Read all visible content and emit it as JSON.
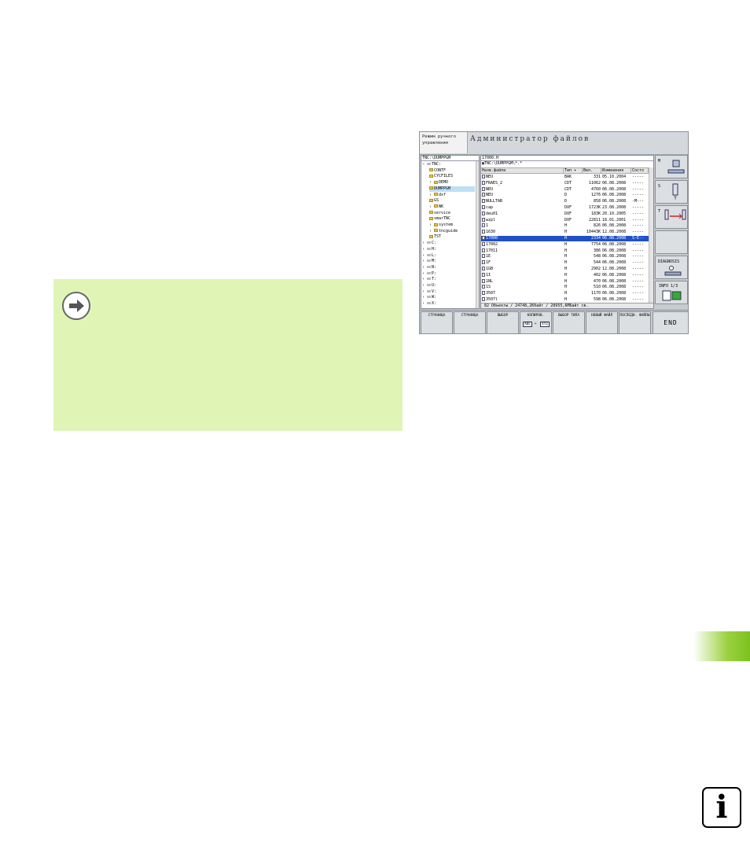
{
  "screen": {
    "mode_label": "Режим ручного управления",
    "title": "Администратор файлов",
    "tree": {
      "path": "TNC:\\DUMPPGM",
      "items": [
        {
          "label": "TNC:",
          "type": "drive-open"
        },
        {
          "label": "CONTF",
          "type": "folder"
        },
        {
          "label": "CYCFILES",
          "type": "folder"
        },
        {
          "label": "DEMO",
          "type": "folder"
        },
        {
          "label": "DUMPPGM",
          "type": "folder",
          "selected": true
        },
        {
          "label": "dxf",
          "type": "folder"
        },
        {
          "label": "GS",
          "type": "folder"
        },
        {
          "label": "NK",
          "type": "folder"
        },
        {
          "label": "service",
          "type": "folder"
        },
        {
          "label": "smarTNC",
          "type": "folder"
        },
        {
          "label": "system",
          "type": "folder"
        },
        {
          "label": "tncguide",
          "type": "folder"
        },
        {
          "label": "TST",
          "type": "folder"
        },
        {
          "label": "C:",
          "type": "drive"
        },
        {
          "label": "H:",
          "type": "drive"
        },
        {
          "label": "L:",
          "type": "drive"
        },
        {
          "label": "M:",
          "type": "drive"
        },
        {
          "label": "N:",
          "type": "drive"
        },
        {
          "label": "P:",
          "type": "drive"
        },
        {
          "label": "T:",
          "type": "drive"
        },
        {
          "label": "U:",
          "type": "drive"
        },
        {
          "label": "V:",
          "type": "drive"
        },
        {
          "label": "W:",
          "type": "drive"
        },
        {
          "label": "X:",
          "type": "drive"
        }
      ]
    },
    "files": {
      "current_file": "17000.H",
      "path": "TNC:\\DUMPPGM\\*.*",
      "columns": [
        "Назв.файла",
        "Тип",
        "Вел.",
        "Изменения",
        "Состо"
      ],
      "rows": [
        {
          "name": "NEU",
          "type": "BAK",
          "size": "331",
          "date": "05.10.2004",
          "status": "-----"
        },
        {
          "name": "FRAES_2",
          "type": "CDT",
          "size": "11062",
          "date": "06.08.2008",
          "status": "-----"
        },
        {
          "name": "NEU",
          "type": "CDT",
          "size": "4760",
          "date": "06.08.2008",
          "status": "-----"
        },
        {
          "name": "NEU",
          "type": "D",
          "size": "1276",
          "date": "06.08.2008",
          "status": "-----"
        },
        {
          "name": "NULLTAB",
          "type": "D",
          "size": "858",
          "date": "06.08.2008",
          "status": "-M---"
        },
        {
          "name": "cap",
          "type": "DXF",
          "size": "1723K",
          "date": "23.08.2008",
          "status": "-----"
        },
        {
          "name": "deu01",
          "type": "DXF",
          "size": "183K",
          "date": "20.10.2005",
          "status": "-----"
        },
        {
          "name": "wzpl",
          "type": "DXF",
          "size": "22811",
          "date": "18.01.2001",
          "status": "-----"
        },
        {
          "name": "1",
          "type": "H",
          "size": "826",
          "date": "06.08.2008",
          "status": "-----"
        },
        {
          "name": "1630",
          "type": "H",
          "size": "10443K",
          "date": "12.08.2008",
          "status": "-----"
        },
        {
          "name": "17000",
          "type": "H",
          "size": "2334",
          "date": "06.08.2008",
          "status": "S-E--",
          "selected": true
        },
        {
          "name": "17002",
          "type": "H",
          "size": "7754",
          "date": "06.08.2008",
          "status": "-----"
        },
        {
          "name": "17011",
          "type": "H",
          "size": "386",
          "date": "06.08.2008",
          "status": "-----"
        },
        {
          "name": "1E",
          "type": "H",
          "size": "548",
          "date": "06.08.2008",
          "status": "-----"
        },
        {
          "name": "1F",
          "type": "H",
          "size": "544",
          "date": "06.08.2008",
          "status": "-----"
        },
        {
          "name": "1GB",
          "type": "H",
          "size": "2902",
          "date": "12.08.2008",
          "status": "-----"
        },
        {
          "name": "1I",
          "type": "H",
          "size": "402",
          "date": "06.08.2008",
          "status": "-----"
        },
        {
          "name": "1NL",
          "type": "H",
          "size": "470",
          "date": "06.08.2008",
          "status": "-----"
        },
        {
          "name": "1S",
          "type": "H",
          "size": "510",
          "date": "06.08.2008",
          "status": "-----"
        },
        {
          "name": "3507",
          "type": "H",
          "size": "1170",
          "date": "06.08.2008",
          "status": "-----"
        },
        {
          "name": "3507l",
          "type": "H",
          "size": "598",
          "date": "06.08.2008",
          "status": "-----"
        }
      ],
      "status_bar": "82 Объекты / 24748,2Кбайт / 28955,6МБайт св."
    },
    "side_keys": [
      {
        "label": "M"
      },
      {
        "label": "S"
      },
      {
        "label": "T"
      },
      {
        "label": ""
      },
      {
        "label": "DIAGNOSIS"
      },
      {
        "label": "INFO 1/3"
      }
    ],
    "soft_keys": [
      {
        "label": "СТРАНИЦА"
      },
      {
        "label": "СТРАНИЦА"
      },
      {
        "label": "ВЫБОР"
      },
      {
        "label": "КОПИРОВ.",
        "sub_from": "ABC",
        "sub_to": "XYZ"
      },
      {
        "label": "ВЫБОР ТИПА"
      },
      {
        "label": "НОВЫЙ ФАЙЛ"
      },
      {
        "label": "ПОСЛЕДН. ФАЙЛЫ"
      },
      {
        "label": "END"
      }
    ]
  },
  "colors": {
    "tip_bg": "#e0f5b5",
    "selection": "#1f50c8",
    "green_tab": "#7cc21e"
  },
  "icons": {
    "tip": "arrow-right-icon",
    "info": "info-icon"
  },
  "info_glyph": "i"
}
